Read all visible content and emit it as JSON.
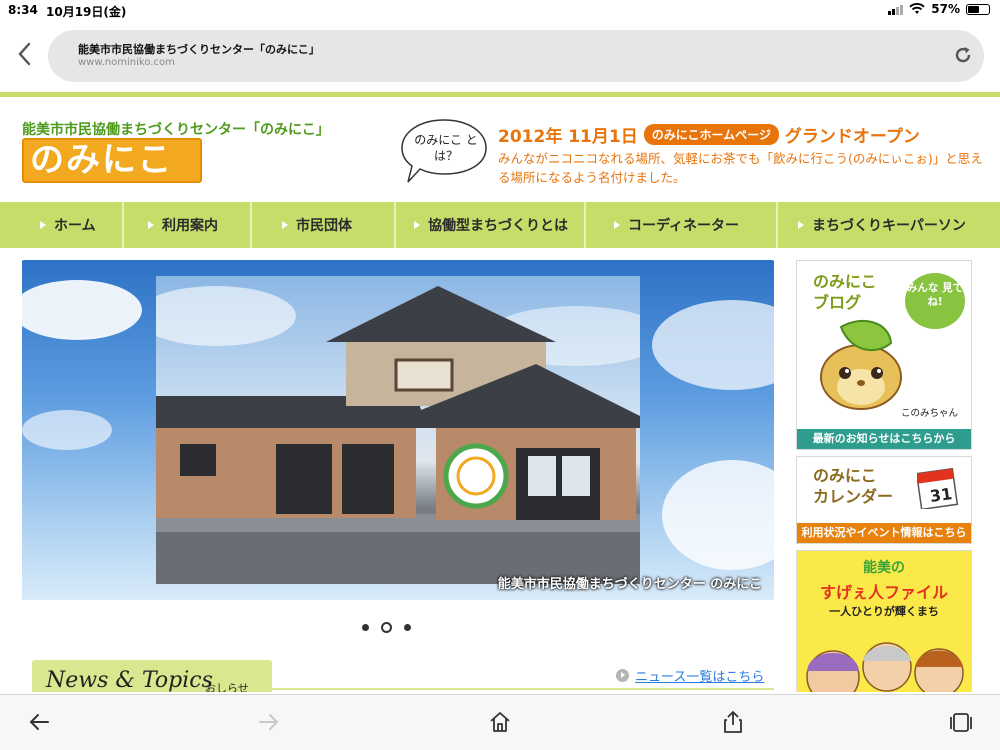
{
  "status_bar": {
    "time": "8:34",
    "date": "10月19日(金)",
    "battery": "57%",
    "battery_level": 0.57
  },
  "browser": {
    "page_title": "能美市市民協働まちづくりセンター「のみにこ」",
    "url": "www.nominiko.com"
  },
  "header": {
    "site_name": "能美市市民協働まちづくりセンター「のみにこ」",
    "logo_text": "のみにこ",
    "bubble_text": "のみにこ とは？",
    "headline_date": "2012年 11月1日",
    "headline_pill": "のみにこホームページ",
    "headline_tail": "グランドオープン",
    "description": "みんながニコニコなれる場所、気軽にお茶でも「飲みに行こう(のみにぃこぉ)」と思える場所になるよう名付けました。"
  },
  "nav": {
    "items": [
      {
        "label": "ホーム"
      },
      {
        "label": "利用案内"
      },
      {
        "label": "市民団体"
      },
      {
        "label": "協働型まちづくりとは"
      },
      {
        "label": "コーディネーター"
      },
      {
        "label": "まちづくりキーパーソン"
      }
    ]
  },
  "hero": {
    "caption": "能美市市民協働まちづくりセンター のみにこ",
    "slide_count": 3,
    "active_slide": 2
  },
  "news": {
    "title": "News & Topics",
    "subtitle": "おしらせ",
    "link": "ニュース一覧はこちら"
  },
  "sidebar": {
    "blog": {
      "title_1": "のみにこ",
      "title_2": "ブログ",
      "bubble": "みんな 見てね!",
      "mascot_caption": "このみちゃん",
      "footer": "最新のお知らせはこちらから"
    },
    "calendar": {
      "title_1": "のみにこ",
      "title_2": "カレンダー",
      "calendar_day": "31",
      "footer": "利用状況やイベント情報はこちら"
    },
    "file": {
      "top": "能美の",
      "main": "すげぇ人ファイル",
      "sub": "一人ひとりが輝くまち"
    }
  },
  "colors": {
    "accent_green": "#c6dd6a",
    "accent_orange": "#e8740c",
    "logo_orange": "#f3a91f",
    "teal": "#2f9d8e"
  }
}
